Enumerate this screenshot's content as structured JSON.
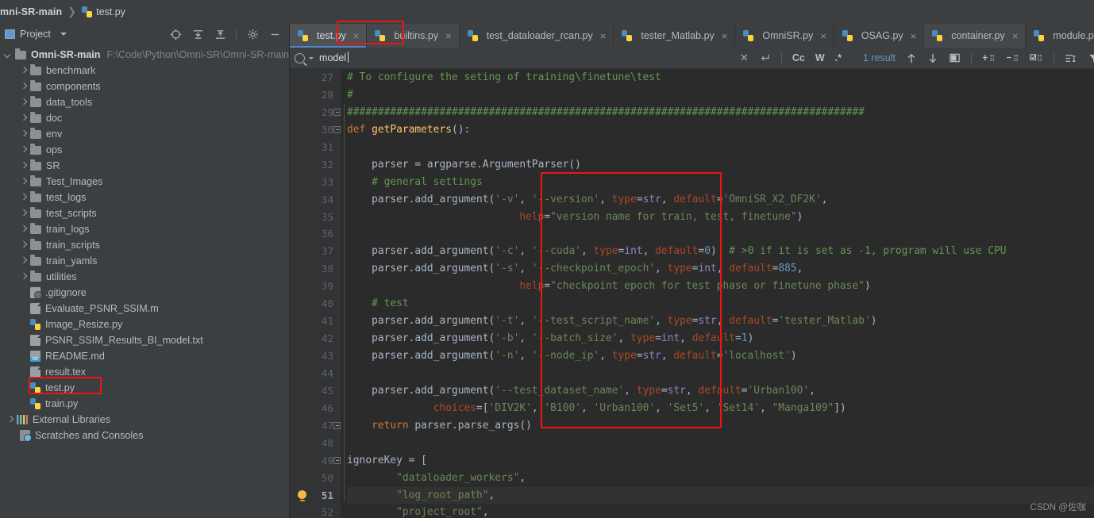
{
  "breadcrumb": {
    "project": "mni-SR-main",
    "separator": "❯",
    "file": "test.py"
  },
  "project_panel": {
    "title": "Project",
    "tools": [
      "locate-icon",
      "expand-all-icon",
      "collapse-all-icon",
      "gear-icon",
      "minimize-icon"
    ],
    "root": {
      "label": "Omni-SR-main",
      "path": "F:\\Code\\Python\\Omni-SR\\Omni-SR-main"
    },
    "items": [
      {
        "label": "benchmark",
        "type": "folder"
      },
      {
        "label": "components",
        "type": "folder"
      },
      {
        "label": "data_tools",
        "type": "folder"
      },
      {
        "label": "doc",
        "type": "folder"
      },
      {
        "label": "env",
        "type": "folder"
      },
      {
        "label": "ops",
        "type": "folder"
      },
      {
        "label": "SR",
        "type": "folder"
      },
      {
        "label": "Test_Images",
        "type": "folder"
      },
      {
        "label": "test_logs",
        "type": "folder"
      },
      {
        "label": "test_scripts",
        "type": "folder"
      },
      {
        "label": "train_logs",
        "type": "folder"
      },
      {
        "label": "train_scripts",
        "type": "folder"
      },
      {
        "label": "train_yamls",
        "type": "folder"
      },
      {
        "label": "utilities",
        "type": "folder"
      },
      {
        "label": ".gitignore",
        "type": "ignore-file"
      },
      {
        "label": "Evaluate_PSNR_SSIM.m",
        "type": "doc-file"
      },
      {
        "label": "Image_Resize.py",
        "type": "python-file"
      },
      {
        "label": "PSNR_SSIM_Results_BI_model.txt",
        "type": "doc-file"
      },
      {
        "label": "README.md",
        "type": "markdown-file"
      },
      {
        "label": "result.tex",
        "type": "doc-file"
      },
      {
        "label": "test.py",
        "type": "python-file",
        "highlighted": true
      },
      {
        "label": "train.py",
        "type": "python-file"
      }
    ],
    "external_libraries": "External Libraries",
    "scratches": "Scratches and Consoles"
  },
  "editor": {
    "tabs": [
      {
        "label": "test.py",
        "active": true
      },
      {
        "label": "builtins.py",
        "shaded": true
      },
      {
        "label": "test_dataloader_rcan.py"
      },
      {
        "label": "tester_Matlab.py"
      },
      {
        "label": "OmniSR.py"
      },
      {
        "label": "OSAG.py"
      },
      {
        "label": "container.py",
        "shaded": true
      },
      {
        "label": "module.py"
      }
    ],
    "close_glyph": "×"
  },
  "find": {
    "query": "model",
    "placeholder": "",
    "result_count": "1 result",
    "toggles": [
      "Cc",
      "W",
      ".*"
    ],
    "icons": [
      "search-icon",
      "clear-icon",
      "regex-history-icon",
      "prev-match-icon",
      "next-match-icon",
      "select-all-icon",
      "add-line-icon",
      "remove-line-icon",
      "select-occurrences-icon",
      "new-line-icon",
      "filter-icon"
    ]
  },
  "code": {
    "first_line_number": 27,
    "current_line": 51,
    "lines": [
      {
        "n": 27,
        "segments": [
          {
            "t": "# To configure the seting of training\\finetune\\test",
            "c": "c-cmt",
            "indent": 1
          }
        ]
      },
      {
        "n": 28,
        "segments": [
          {
            "t": "#",
            "c": "c-cmt",
            "indent": 1
          }
        ]
      },
      {
        "n": 29,
        "segments": [
          {
            "t": "####################################################################################",
            "c": "c-cmt",
            "indent": 1
          }
        ]
      },
      {
        "n": 30,
        "segments": [
          {
            "t": "def ",
            "c": "c-kw",
            "indent": 1
          },
          {
            "t": "getParameters",
            "c": "c-fn"
          },
          {
            "t": "():",
            "c": "c-def"
          }
        ]
      },
      {
        "n": 31,
        "segments": []
      },
      {
        "n": 32,
        "segments": [
          {
            "t": "    parser = argparse.ArgumentParser()",
            "c": "c-def",
            "indent": 1
          }
        ]
      },
      {
        "n": 33,
        "segments": [
          {
            "t": "    # general settings",
            "c": "c-cmt",
            "indent": 1
          }
        ]
      },
      {
        "n": 34,
        "segments": [
          {
            "t": "    parser.add_argument(",
            "c": "c-def"
          },
          {
            "t": "'-v'",
            "c": "c-str"
          },
          {
            "t": ", ",
            "c": "c-def"
          },
          {
            "t": "'--version'",
            "c": "c-str"
          },
          {
            "t": ", ",
            "c": "c-def"
          },
          {
            "t": "type",
            "c": "c-kwarg"
          },
          {
            "t": "=",
            "c": "c-def"
          },
          {
            "t": "str",
            "c": "c-pred"
          },
          {
            "t": ", ",
            "c": "c-def"
          },
          {
            "t": "default",
            "c": "c-kwarg"
          },
          {
            "t": "=",
            "c": "c-def"
          },
          {
            "t": "'OmniSR_X2_DF2K'",
            "c": "c-str"
          },
          {
            "t": ",",
            "c": "c-def"
          }
        ]
      },
      {
        "n": 35,
        "segments": [
          {
            "t": "                            ",
            "c": "c-def"
          },
          {
            "t": "help",
            "c": "c-kwarg"
          },
          {
            "t": "=",
            "c": "c-def"
          },
          {
            "t": "\"version name for train, test, finetune\"",
            "c": "c-str"
          },
          {
            "t": ")",
            "c": "c-def"
          }
        ]
      },
      {
        "n": 36,
        "segments": []
      },
      {
        "n": 37,
        "segments": [
          {
            "t": "    parser.add_argument(",
            "c": "c-def"
          },
          {
            "t": "'-c'",
            "c": "c-str"
          },
          {
            "t": ", ",
            "c": "c-def"
          },
          {
            "t": "'--cuda'",
            "c": "c-str"
          },
          {
            "t": ", ",
            "c": "c-def"
          },
          {
            "t": "type",
            "c": "c-kwarg"
          },
          {
            "t": "=",
            "c": "c-def"
          },
          {
            "t": "int",
            "c": "c-pred"
          },
          {
            "t": ", ",
            "c": "c-def"
          },
          {
            "t": "default",
            "c": "c-kwarg"
          },
          {
            "t": "=",
            "c": "c-def"
          },
          {
            "t": "0",
            "c": "c-num"
          },
          {
            "t": ")  ",
            "c": "c-def"
          },
          {
            "t": "# >0 if it is set as -1, program will use CPU",
            "c": "c-cmt"
          }
        ]
      },
      {
        "n": 38,
        "segments": [
          {
            "t": "    parser.add_argument(",
            "c": "c-def"
          },
          {
            "t": "'-s'",
            "c": "c-str"
          },
          {
            "t": ", ",
            "c": "c-def"
          },
          {
            "t": "'--checkpoint_epoch'",
            "c": "c-str"
          },
          {
            "t": ", ",
            "c": "c-def"
          },
          {
            "t": "type",
            "c": "c-kwarg"
          },
          {
            "t": "=",
            "c": "c-def"
          },
          {
            "t": "int",
            "c": "c-pred"
          },
          {
            "t": ", ",
            "c": "c-def"
          },
          {
            "t": "default",
            "c": "c-kwarg"
          },
          {
            "t": "=",
            "c": "c-def"
          },
          {
            "t": "885",
            "c": "c-num"
          },
          {
            "t": ",",
            "c": "c-def"
          }
        ]
      },
      {
        "n": 39,
        "segments": [
          {
            "t": "                            ",
            "c": "c-def"
          },
          {
            "t": "help",
            "c": "c-kwarg"
          },
          {
            "t": "=",
            "c": "c-def"
          },
          {
            "t": "\"checkpoint epoch for test phase or finetune phase\"",
            "c": "c-str"
          },
          {
            "t": ")",
            "c": "c-def"
          }
        ]
      },
      {
        "n": 40,
        "segments": [
          {
            "t": "    # test",
            "c": "c-cmt",
            "indent": 1
          }
        ]
      },
      {
        "n": 41,
        "segments": [
          {
            "t": "    parser.add_argument(",
            "c": "c-def"
          },
          {
            "t": "'-t'",
            "c": "c-str"
          },
          {
            "t": ", ",
            "c": "c-def"
          },
          {
            "t": "'--test_script_name'",
            "c": "c-str"
          },
          {
            "t": ", ",
            "c": "c-def"
          },
          {
            "t": "type",
            "c": "c-kwarg"
          },
          {
            "t": "=",
            "c": "c-def"
          },
          {
            "t": "str",
            "c": "c-pred"
          },
          {
            "t": ", ",
            "c": "c-def"
          },
          {
            "t": "default",
            "c": "c-kwarg"
          },
          {
            "t": "=",
            "c": "c-def"
          },
          {
            "t": "'tester_Matlab'",
            "c": "c-str"
          },
          {
            "t": ")",
            "c": "c-def"
          }
        ]
      },
      {
        "n": 42,
        "segments": [
          {
            "t": "    parser.add_argument(",
            "c": "c-def"
          },
          {
            "t": "'-b'",
            "c": "c-str"
          },
          {
            "t": ", ",
            "c": "c-def"
          },
          {
            "t": "'--batch_size'",
            "c": "c-str"
          },
          {
            "t": ", ",
            "c": "c-def"
          },
          {
            "t": "type",
            "c": "c-kwarg"
          },
          {
            "t": "=",
            "c": "c-def"
          },
          {
            "t": "int",
            "c": "c-pred"
          },
          {
            "t": ", ",
            "c": "c-def"
          },
          {
            "t": "default",
            "c": "c-kwarg"
          },
          {
            "t": "=",
            "c": "c-def"
          },
          {
            "t": "1",
            "c": "c-num"
          },
          {
            "t": ")",
            "c": "c-def"
          }
        ]
      },
      {
        "n": 43,
        "segments": [
          {
            "t": "    parser.add_argument(",
            "c": "c-def"
          },
          {
            "t": "'-n'",
            "c": "c-str"
          },
          {
            "t": ", ",
            "c": "c-def"
          },
          {
            "t": "'--node_ip'",
            "c": "c-str"
          },
          {
            "t": ", ",
            "c": "c-def"
          },
          {
            "t": "type",
            "c": "c-kwarg"
          },
          {
            "t": "=",
            "c": "c-def"
          },
          {
            "t": "str",
            "c": "c-pred"
          },
          {
            "t": ", ",
            "c": "c-def"
          },
          {
            "t": "default",
            "c": "c-kwarg"
          },
          {
            "t": "=",
            "c": "c-def"
          },
          {
            "t": "'localhost'",
            "c": "c-str"
          },
          {
            "t": ")",
            "c": "c-def"
          }
        ]
      },
      {
        "n": 44,
        "segments": []
      },
      {
        "n": 45,
        "segments": [
          {
            "t": "    parser.add_argument(",
            "c": "c-def"
          },
          {
            "t": "'--test_dataset_name'",
            "c": "c-str"
          },
          {
            "t": ", ",
            "c": "c-def"
          },
          {
            "t": "type",
            "c": "c-kwarg"
          },
          {
            "t": "=",
            "c": "c-def"
          },
          {
            "t": "str",
            "c": "c-pred"
          },
          {
            "t": ", ",
            "c": "c-def"
          },
          {
            "t": "default",
            "c": "c-kwarg"
          },
          {
            "t": "=",
            "c": "c-def"
          },
          {
            "t": "'Urban100'",
            "c": "c-str"
          },
          {
            "t": ",",
            "c": "c-def"
          }
        ]
      },
      {
        "n": 46,
        "segments": [
          {
            "t": "              ",
            "c": "c-def"
          },
          {
            "t": "choices",
            "c": "c-kwarg"
          },
          {
            "t": "=[",
            "c": "c-def"
          },
          {
            "t": "'DIV2K'",
            "c": "c-str"
          },
          {
            "t": ", ",
            "c": "c-def"
          },
          {
            "t": "'B100'",
            "c": "c-str"
          },
          {
            "t": ", ",
            "c": "c-def"
          },
          {
            "t": "'Urban100'",
            "c": "c-str"
          },
          {
            "t": ", ",
            "c": "c-def"
          },
          {
            "t": "'Set5'",
            "c": "c-str"
          },
          {
            "t": ", ",
            "c": "c-def"
          },
          {
            "t": "'Set14'",
            "c": "c-str"
          },
          {
            "t": ", ",
            "c": "c-def"
          },
          {
            "t": "\"Manga109\"",
            "c": "c-str"
          },
          {
            "t": "])",
            "c": "c-def"
          }
        ]
      },
      {
        "n": 47,
        "segments": [
          {
            "t": "    return",
            "c": "c-kw"
          },
          {
            "t": " parser.parse_args()",
            "c": "c-def"
          }
        ]
      },
      {
        "n": 48,
        "segments": []
      },
      {
        "n": 49,
        "segments": [
          {
            "t": "ignoreKey = [",
            "c": "c-def",
            "indent": 1
          }
        ]
      },
      {
        "n": 50,
        "segments": [
          {
            "t": "        ",
            "c": "c-def"
          },
          {
            "t": "\"dataloader_workers\"",
            "c": "c-str"
          },
          {
            "t": ",",
            "c": "c-def"
          }
        ]
      },
      {
        "n": 51,
        "segments": [
          {
            "t": "        ",
            "c": "c-def"
          },
          {
            "t": "\"log_root_path\"",
            "c": "c-str"
          },
          {
            "t": ",",
            "c": "c-def"
          }
        ]
      },
      {
        "n": 52,
        "segments": [
          {
            "t": "        ",
            "c": "c-def"
          },
          {
            "t": "\"project_root\"",
            "c": "c-str"
          },
          {
            "t": ",",
            "c": "c-def"
          }
        ]
      }
    ]
  },
  "annotations": {
    "highlight_color": "#f11414",
    "boxes": [
      "test-py-tree-item",
      "test-py-tab",
      "argparse-block"
    ]
  },
  "watermark": "CSDN @佐咖"
}
